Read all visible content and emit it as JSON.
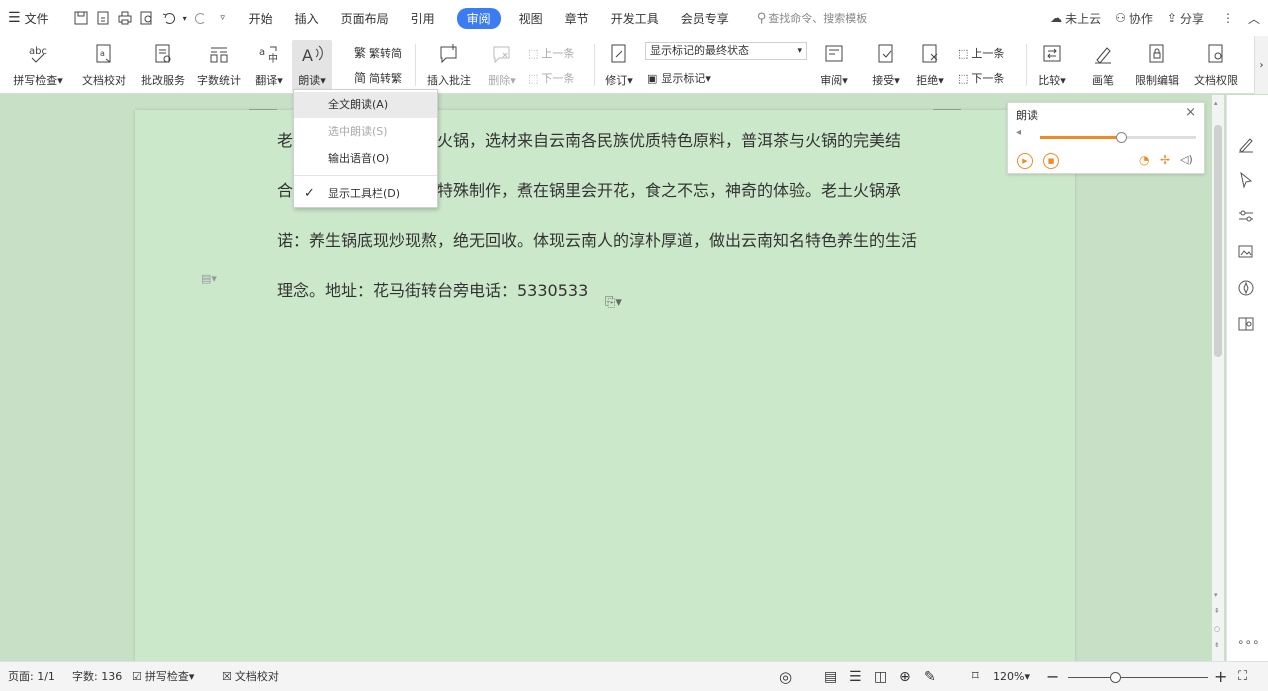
{
  "titlebar": {
    "file_label": "文件",
    "tabs": [
      "开始",
      "插入",
      "页面布局",
      "引用",
      "审阅",
      "视图",
      "章节",
      "开发工具",
      "会员专享"
    ],
    "active_tab": "审阅",
    "search_placeholder": "查找命令、搜索模板",
    "cloud_label": "未上云",
    "collab_label": "协作",
    "share_label": "分享"
  },
  "ribbon": {
    "spell_check": "拼写检查",
    "doc_proof": "文档校对",
    "revise_service": "批改服务",
    "word_count": "字数统计",
    "translate": "翻译",
    "read_aloud": "朗读",
    "trad_to_simp": "繁转简",
    "simp_to_trad": "简转繁",
    "insert_comment": "插入批注",
    "delete": "删除",
    "prev_comment": "上一条",
    "next_comment": "下一条",
    "track_changes": "修订",
    "markup_state": "显示标记的最终状态",
    "show_markup": "显示标记",
    "review": "审阅",
    "accept": "接受",
    "reject": "拒绝",
    "prev_change": "上一条",
    "next_change": "下一条",
    "compare": "比较",
    "pen": "画笔",
    "restrict_edit": "限制编辑",
    "doc_permission": "文档权限"
  },
  "menu": {
    "items": [
      {
        "label": "全文朗读(A)",
        "state": "highlighted"
      },
      {
        "label": "选中朗读(S)",
        "state": "disabled"
      },
      {
        "label": "输出语音(O)",
        "state": "normal"
      },
      {
        "label": "显示工具栏(D)",
        "state": "checked"
      }
    ]
  },
  "read_panel": {
    "title": "朗读",
    "volume_percent": 52
  },
  "document": {
    "lines": [
      "老土火锅是云南特色的火锅，选材来自云南各民族优质特色原料，普洱茶与火锅的完美结",
      "合，豆腐选用石屏豆腐特殊制作，煮在锅里会开花，食之不忘，神奇的体验。老土火锅承",
      "诺：养生锅底现炒现熬，绝无回收。体现云南人的淳朴厚道，做出云南知名特色养生的生活",
      "理念。地址：花马街转台旁电话：5330533"
    ]
  },
  "statusbar": {
    "page": "页面: 1/1",
    "word_count": "字数: 136",
    "spell_check": "拼写检查",
    "doc_proof": "文档校对",
    "zoom": "120%",
    "zoom_percent": 120
  },
  "colors": {
    "accent": "#3b7cf3",
    "canvas": "#c8e0c5",
    "page": "#cce8cb",
    "read_accent": "#f08a24"
  }
}
